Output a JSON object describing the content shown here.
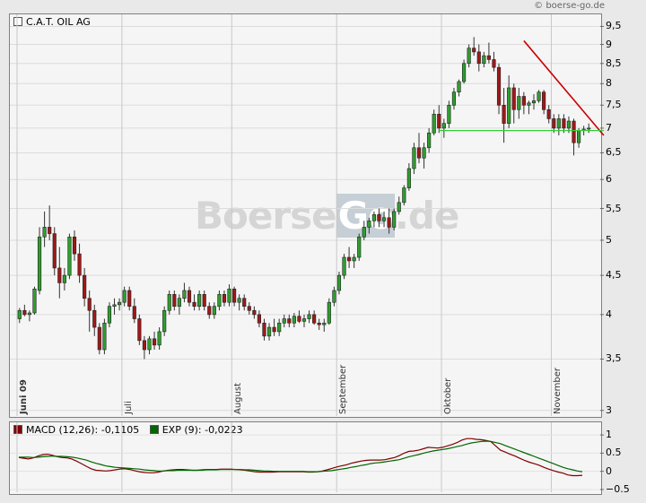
{
  "header": {
    "copyright": "© boerse-go.de",
    "instrument": "C.A.T. OIL AG",
    "watermark": {
      "part1": "Boerse",
      "part2": "Go",
      "part3": ".de"
    }
  },
  "chart_data": [
    {
      "type": "candlestick",
      "title": "C.A.T. OIL AG",
      "y_scale": "log",
      "ylim": [
        2.95,
        9.85
      ],
      "y_ticks": [
        "3",
        "3,5",
        "4",
        "4,5",
        "5",
        "5,5",
        "6",
        "6,5",
        "7",
        "7,5",
        "8",
        "8,5",
        "9",
        "9,5"
      ],
      "y_tick_values": [
        3,
        3.5,
        4,
        4.5,
        5,
        5.5,
        6,
        6.5,
        7,
        7.5,
        8,
        8.5,
        9,
        9.5
      ],
      "x_month_labels": [
        "Juni 09",
        "Juli",
        "August",
        "September",
        "Oktober",
        "November"
      ],
      "x_month_start_index": [
        0,
        21,
        43,
        64,
        85,
        107
      ],
      "candles": [
        {
          "o": 3.95,
          "h": 4.08,
          "l": 3.9,
          "c": 4.05
        },
        {
          "o": 4.05,
          "h": 4.12,
          "l": 3.98,
          "c": 4.0
        },
        {
          "o": 4.0,
          "h": 4.05,
          "l": 3.92,
          "c": 4.02
        },
        {
          "o": 4.02,
          "h": 4.35,
          "l": 4.0,
          "c": 4.32
        },
        {
          "o": 4.3,
          "h": 5.2,
          "l": 4.25,
          "c": 5.05
        },
        {
          "o": 5.05,
          "h": 5.45,
          "l": 4.9,
          "c": 5.2
        },
        {
          "o": 5.2,
          "h": 5.55,
          "l": 5.0,
          "c": 5.1
        },
        {
          "o": 5.1,
          "h": 5.2,
          "l": 4.5,
          "c": 4.6
        },
        {
          "o": 4.6,
          "h": 4.9,
          "l": 4.2,
          "c": 4.4
        },
        {
          "o": 4.4,
          "h": 4.6,
          "l": 4.3,
          "c": 4.5
        },
        {
          "o": 4.5,
          "h": 5.1,
          "l": 4.45,
          "c": 5.05
        },
        {
          "o": 5.05,
          "h": 5.15,
          "l": 4.7,
          "c": 4.8
        },
        {
          "o": 4.8,
          "h": 4.95,
          "l": 4.4,
          "c": 4.5
        },
        {
          "o": 4.5,
          "h": 4.6,
          "l": 4.1,
          "c": 4.2
        },
        {
          "o": 4.2,
          "h": 4.3,
          "l": 3.8,
          "c": 4.05
        },
        {
          "o": 4.05,
          "h": 4.12,
          "l": 3.75,
          "c": 3.85
        },
        {
          "o": 3.85,
          "h": 3.9,
          "l": 3.55,
          "c": 3.6
        },
        {
          "o": 3.6,
          "h": 3.95,
          "l": 3.55,
          "c": 3.9
        },
        {
          "o": 3.9,
          "h": 4.15,
          "l": 3.85,
          "c": 4.1
        },
        {
          "o": 4.1,
          "h": 4.2,
          "l": 4.0,
          "c": 4.12
        },
        {
          "o": 4.12,
          "h": 4.2,
          "l": 4.05,
          "c": 4.15
        },
        {
          "o": 4.15,
          "h": 4.35,
          "l": 4.1,
          "c": 4.3
        },
        {
          "o": 4.3,
          "h": 4.35,
          "l": 4.05,
          "c": 4.1
        },
        {
          "o": 4.1,
          "h": 4.2,
          "l": 3.9,
          "c": 3.95
        },
        {
          "o": 3.95,
          "h": 4.0,
          "l": 3.65,
          "c": 3.7
        },
        {
          "o": 3.7,
          "h": 3.75,
          "l": 3.5,
          "c": 3.6
        },
        {
          "o": 3.6,
          "h": 3.75,
          "l": 3.55,
          "c": 3.72
        },
        {
          "o": 3.72,
          "h": 3.8,
          "l": 3.6,
          "c": 3.65
        },
        {
          "o": 3.65,
          "h": 3.85,
          "l": 3.6,
          "c": 3.8
        },
        {
          "o": 3.8,
          "h": 4.1,
          "l": 3.75,
          "c": 4.05
        },
        {
          "o": 4.05,
          "h": 4.3,
          "l": 4.0,
          "c": 4.25
        },
        {
          "o": 4.25,
          "h": 4.3,
          "l": 4.05,
          "c": 4.1
        },
        {
          "o": 4.1,
          "h": 4.25,
          "l": 4.0,
          "c": 4.2
        },
        {
          "o": 4.2,
          "h": 4.4,
          "l": 4.15,
          "c": 4.3
        },
        {
          "o": 4.3,
          "h": 4.35,
          "l": 4.1,
          "c": 4.15
        },
        {
          "o": 4.15,
          "h": 4.25,
          "l": 4.05,
          "c": 4.1
        },
        {
          "o": 4.1,
          "h": 4.3,
          "l": 4.05,
          "c": 4.25
        },
        {
          "o": 4.25,
          "h": 4.3,
          "l": 4.05,
          "c": 4.1
        },
        {
          "o": 4.1,
          "h": 4.15,
          "l": 3.95,
          "c": 4.0
        },
        {
          "o": 4.0,
          "h": 4.15,
          "l": 3.95,
          "c": 4.1
        },
        {
          "o": 4.1,
          "h": 4.3,
          "l": 4.05,
          "c": 4.25
        },
        {
          "o": 4.25,
          "h": 4.3,
          "l": 4.1,
          "c": 4.15
        },
        {
          "o": 4.15,
          "h": 4.38,
          "l": 4.1,
          "c": 4.32
        },
        {
          "o": 4.32,
          "h": 4.35,
          "l": 4.1,
          "c": 4.15
        },
        {
          "o": 4.15,
          "h": 4.25,
          "l": 4.05,
          "c": 4.2
        },
        {
          "o": 4.2,
          "h": 4.25,
          "l": 4.05,
          "c": 4.1
        },
        {
          "o": 4.1,
          "h": 4.15,
          "l": 4.0,
          "c": 4.05
        },
        {
          "o": 4.05,
          "h": 4.1,
          "l": 3.95,
          "c": 4.0
        },
        {
          "o": 4.0,
          "h": 4.05,
          "l": 3.85,
          "c": 3.9
        },
        {
          "o": 3.9,
          "h": 3.95,
          "l": 3.7,
          "c": 3.75
        },
        {
          "o": 3.75,
          "h": 3.9,
          "l": 3.7,
          "c": 3.85
        },
        {
          "o": 3.85,
          "h": 3.95,
          "l": 3.75,
          "c": 3.8
        },
        {
          "o": 3.8,
          "h": 3.95,
          "l": 3.75,
          "c": 3.9
        },
        {
          "o": 3.9,
          "h": 4.0,
          "l": 3.85,
          "c": 3.95
        },
        {
          "o": 3.95,
          "h": 4.0,
          "l": 3.85,
          "c": 3.9
        },
        {
          "o": 3.9,
          "h": 4.02,
          "l": 3.85,
          "c": 3.98
        },
        {
          "o": 3.98,
          "h": 4.05,
          "l": 3.9,
          "c": 3.92
        },
        {
          "o": 3.92,
          "h": 4.0,
          "l": 3.85,
          "c": 3.95
        },
        {
          "o": 3.95,
          "h": 4.05,
          "l": 3.9,
          "c": 4.0
        },
        {
          "o": 4.0,
          "h": 4.05,
          "l": 3.88,
          "c": 3.9
        },
        {
          "o": 3.9,
          "h": 3.95,
          "l": 3.82,
          "c": 3.88
        },
        {
          "o": 3.88,
          "h": 3.95,
          "l": 3.8,
          "c": 3.9
        },
        {
          "o": 3.9,
          "h": 4.2,
          "l": 3.88,
          "c": 4.15
        },
        {
          "o": 4.15,
          "h": 4.35,
          "l": 4.1,
          "c": 4.3
        },
        {
          "o": 4.3,
          "h": 4.55,
          "l": 4.25,
          "c": 4.5
        },
        {
          "o": 4.5,
          "h": 4.8,
          "l": 4.45,
          "c": 4.75
        },
        {
          "o": 4.75,
          "h": 4.9,
          "l": 4.6,
          "c": 4.7
        },
        {
          "o": 4.7,
          "h": 4.8,
          "l": 4.6,
          "c": 4.75
        },
        {
          "o": 4.75,
          "h": 5.1,
          "l": 4.7,
          "c": 5.05
        },
        {
          "o": 5.05,
          "h": 5.3,
          "l": 5.0,
          "c": 5.2
        },
        {
          "o": 5.2,
          "h": 5.35,
          "l": 5.1,
          "c": 5.3
        },
        {
          "o": 5.3,
          "h": 5.45,
          "l": 5.2,
          "c": 5.4
        },
        {
          "o": 5.4,
          "h": 5.5,
          "l": 5.2,
          "c": 5.3
        },
        {
          "o": 5.3,
          "h": 5.45,
          "l": 5.2,
          "c": 5.35
        },
        {
          "o": 5.35,
          "h": 5.5,
          "l": 5.1,
          "c": 5.2
        },
        {
          "o": 5.2,
          "h": 5.5,
          "l": 5.15,
          "c": 5.45
        },
        {
          "o": 5.45,
          "h": 5.7,
          "l": 5.4,
          "c": 5.6
        },
        {
          "o": 5.6,
          "h": 5.9,
          "l": 5.55,
          "c": 5.85
        },
        {
          "o": 5.85,
          "h": 6.3,
          "l": 5.8,
          "c": 6.2
        },
        {
          "o": 6.2,
          "h": 6.7,
          "l": 6.1,
          "c": 6.6
        },
        {
          "o": 6.6,
          "h": 6.9,
          "l": 6.3,
          "c": 6.4
        },
        {
          "o": 6.4,
          "h": 6.7,
          "l": 6.2,
          "c": 6.6
        },
        {
          "o": 6.6,
          "h": 7.0,
          "l": 6.5,
          "c": 6.9
        },
        {
          "o": 6.9,
          "h": 7.4,
          "l": 6.85,
          "c": 7.3
        },
        {
          "o": 7.3,
          "h": 7.5,
          "l": 6.9,
          "c": 7.0
        },
        {
          "o": 7.0,
          "h": 7.2,
          "l": 6.8,
          "c": 7.1
        },
        {
          "o": 7.1,
          "h": 7.6,
          "l": 7.0,
          "c": 7.5
        },
        {
          "o": 7.5,
          "h": 7.9,
          "l": 7.4,
          "c": 7.8
        },
        {
          "o": 7.8,
          "h": 8.1,
          "l": 7.7,
          "c": 8.05
        },
        {
          "o": 8.05,
          "h": 8.6,
          "l": 8.0,
          "c": 8.5
        },
        {
          "o": 8.5,
          "h": 9.0,
          "l": 8.4,
          "c": 8.9
        },
        {
          "o": 8.9,
          "h": 9.2,
          "l": 8.7,
          "c": 8.8
        },
        {
          "o": 8.8,
          "h": 9.0,
          "l": 8.3,
          "c": 8.5
        },
        {
          "o": 8.5,
          "h": 8.8,
          "l": 8.4,
          "c": 8.7
        },
        {
          "o": 8.7,
          "h": 9.05,
          "l": 8.5,
          "c": 8.6
        },
        {
          "o": 8.6,
          "h": 8.8,
          "l": 8.3,
          "c": 8.4
        },
        {
          "o": 8.4,
          "h": 8.5,
          "l": 7.3,
          "c": 7.5
        },
        {
          "o": 7.5,
          "h": 7.9,
          "l": 6.7,
          "c": 7.1
        },
        {
          "o": 7.1,
          "h": 8.2,
          "l": 7.0,
          "c": 7.9
        },
        {
          "o": 7.9,
          "h": 8.0,
          "l": 7.1,
          "c": 7.4
        },
        {
          "o": 7.4,
          "h": 7.9,
          "l": 7.2,
          "c": 7.7
        },
        {
          "o": 7.7,
          "h": 7.8,
          "l": 7.3,
          "c": 7.5
        },
        {
          "o": 7.5,
          "h": 7.6,
          "l": 7.3,
          "c": 7.55
        },
        {
          "o": 7.55,
          "h": 7.75,
          "l": 7.4,
          "c": 7.6
        },
        {
          "o": 7.6,
          "h": 7.85,
          "l": 7.55,
          "c": 7.8
        },
        {
          "o": 7.8,
          "h": 7.85,
          "l": 7.3,
          "c": 7.4
        },
        {
          "o": 7.4,
          "h": 7.5,
          "l": 7.1,
          "c": 7.2
        },
        {
          "o": 7.2,
          "h": 7.3,
          "l": 6.9,
          "c": 7.0
        },
        {
          "o": 7.0,
          "h": 7.3,
          "l": 6.85,
          "c": 7.2
        },
        {
          "o": 7.2,
          "h": 7.3,
          "l": 6.9,
          "c": 7.0
        },
        {
          "o": 7.0,
          "h": 7.25,
          "l": 6.9,
          "c": 7.15
        },
        {
          "o": 7.15,
          "h": 7.2,
          "l": 6.45,
          "c": 6.7
        },
        {
          "o": 6.7,
          "h": 7.0,
          "l": 6.6,
          "c": 6.95
        },
        {
          "o": 6.95,
          "h": 7.05,
          "l": 6.85,
          "c": 6.98
        },
        {
          "o": 6.98,
          "h": 7.1,
          "l": 6.9,
          "c": 7.0
        }
      ],
      "overlays": [
        {
          "name": "trendline-red",
          "color": "#cc0000",
          "from": {
            "index": 101,
            "price": 9.1
          },
          "to": {
            "index": 117,
            "price": 6.85
          }
        },
        {
          "name": "support-green",
          "color": "#33cc33",
          "from": {
            "index": 84,
            "price": 6.95
          },
          "to": {
            "index": 117,
            "price": 6.95
          }
        }
      ]
    },
    {
      "type": "line",
      "title": "MACD",
      "ylim": [
        -0.6,
        1.2
      ],
      "y_ticks": [
        "1",
        "0.5",
        "0",
        "−0.5"
      ],
      "y_tick_values": [
        1,
        0.5,
        0,
        -0.5
      ],
      "series": [
        {
          "name": "MACD (12,26): -0,1105",
          "color": "#800000",
          "values": [
            0.38,
            0.36,
            0.34,
            0.37,
            0.42,
            0.46,
            0.47,
            0.44,
            0.4,
            0.38,
            0.37,
            0.34,
            0.28,
            0.21,
            0.14,
            0.07,
            0.03,
            0.02,
            0.01,
            0.02,
            0.04,
            0.06,
            0.07,
            0.05,
            0.02,
            -0.01,
            -0.03,
            -0.04,
            -0.04,
            -0.02,
            0.01,
            0.03,
            0.04,
            0.05,
            0.05,
            0.04,
            0.03,
            0.03,
            0.04,
            0.05,
            0.05,
            0.05,
            0.06,
            0.06,
            0.06,
            0.05,
            0.04,
            0.03,
            0.01,
            -0.01,
            -0.02,
            -0.02,
            -0.02,
            -0.02,
            -0.01,
            -0.01,
            -0.01,
            -0.01,
            -0.01,
            -0.01,
            -0.02,
            -0.02,
            -0.01,
            0.01,
            0.04,
            0.08,
            0.12,
            0.15,
            0.18,
            0.22,
            0.25,
            0.28,
            0.3,
            0.31,
            0.31,
            0.31,
            0.32,
            0.35,
            0.38,
            0.43,
            0.5,
            0.55,
            0.56,
            0.58,
            0.62,
            0.66,
            0.65,
            0.64,
            0.66,
            0.7,
            0.74,
            0.79,
            0.86,
            0.9,
            0.9,
            0.88,
            0.87,
            0.85,
            0.82,
            0.7,
            0.58,
            0.53,
            0.47,
            0.42,
            0.36,
            0.3,
            0.25,
            0.21,
            0.17,
            0.11,
            0.06,
            0.02,
            -0.02,
            -0.05,
            -0.1,
            -0.12,
            -0.12,
            -0.11
          ]
        },
        {
          "name": "EXP (9): -0,0223",
          "color": "#006600",
          "values": [
            0.39,
            0.39,
            0.39,
            0.38,
            0.39,
            0.4,
            0.41,
            0.42,
            0.41,
            0.41,
            0.4,
            0.39,
            0.37,
            0.34,
            0.31,
            0.26,
            0.22,
            0.19,
            0.15,
            0.13,
            0.11,
            0.1,
            0.09,
            0.08,
            0.07,
            0.06,
            0.04,
            0.03,
            0.02,
            0.01,
            0.01,
            0.02,
            0.02,
            0.03,
            0.03,
            0.03,
            0.03,
            0.03,
            0.03,
            0.04,
            0.04,
            0.04,
            0.05,
            0.05,
            0.05,
            0.05,
            0.05,
            0.04,
            0.04,
            0.03,
            0.02,
            0.01,
            0.01,
            0.0,
            0.0,
            0.0,
            0.0,
            0.0,
            0.0,
            0.0,
            -0.01,
            -0.01,
            -0.01,
            0.0,
            0.01,
            0.02,
            0.04,
            0.06,
            0.08,
            0.11,
            0.13,
            0.16,
            0.18,
            0.21,
            0.23,
            0.24,
            0.26,
            0.28,
            0.3,
            0.32,
            0.36,
            0.4,
            0.43,
            0.46,
            0.5,
            0.53,
            0.56,
            0.58,
            0.6,
            0.62,
            0.65,
            0.68,
            0.71,
            0.75,
            0.78,
            0.8,
            0.82,
            0.83,
            0.82,
            0.79,
            0.76,
            0.71,
            0.66,
            0.61,
            0.56,
            0.51,
            0.46,
            0.41,
            0.36,
            0.31,
            0.26,
            0.21,
            0.16,
            0.11,
            0.07,
            0.04,
            0.01,
            -0.01
          ]
        }
      ]
    }
  ]
}
